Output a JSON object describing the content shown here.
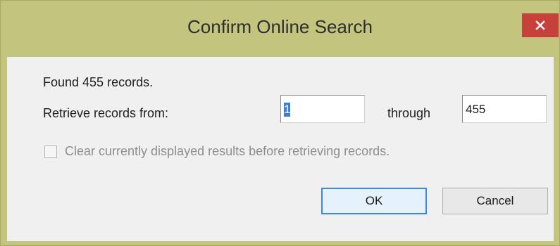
{
  "dialog": {
    "title": "Confirm Online Search",
    "found_text": "Found 455 records.",
    "retrieve_label": "Retrieve records from:",
    "from_value": "1",
    "through_label": "through",
    "to_value": "455",
    "clear_checkbox": {
      "label": "Clear currently displayed results before retrieving records.",
      "checked": false,
      "enabled": false
    },
    "ok_label": "OK",
    "cancel_label": "Cancel"
  },
  "icons": {
    "close": "close-icon"
  },
  "colors": {
    "frame": "#c3c57e",
    "close_button": "#c7413b",
    "default_button_border": "#3c8ad8",
    "selection": "#3c7fd6"
  }
}
